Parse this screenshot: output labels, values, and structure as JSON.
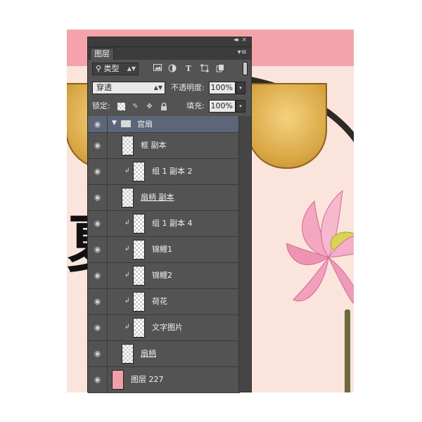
{
  "panel": {
    "title": "图层",
    "collapse_glyph": "◂◂",
    "close_glyph": "×",
    "menu_glyph": "▾≡"
  },
  "filter": {
    "search_glyph": "⚲",
    "kind_label": "类型",
    "icons": [
      "image-filter-icon",
      "adjustment-filter-icon",
      "type-filter-icon",
      "shape-filter-icon",
      "smart-object-filter-icon"
    ]
  },
  "blend": {
    "mode": "穿透",
    "opacity_label": "不透明度:",
    "opacity_value": "100%"
  },
  "lock": {
    "label": "锁定:",
    "fill_label": "填充:",
    "fill_value": "100%"
  },
  "layers": [
    {
      "name": "宫扇",
      "kind": "group",
      "indent": 0
    },
    {
      "name": "框 副本",
      "kind": "layer",
      "indent": 1
    },
    {
      "name": "组 1 副本 2",
      "kind": "clipped",
      "indent": 1
    },
    {
      "name": "扇柄 副本",
      "kind": "layer",
      "indent": 1,
      "underline": true
    },
    {
      "name": "组 1 副本 4",
      "kind": "clipped",
      "indent": 1
    },
    {
      "name": "锦鲤1",
      "kind": "clipped",
      "indent": 1
    },
    {
      "name": "锦鲤2",
      "kind": "clipped",
      "indent": 1
    },
    {
      "name": "荷花",
      "kind": "clipped",
      "indent": 1
    },
    {
      "name": "文字图片",
      "kind": "clipped",
      "indent": 1
    },
    {
      "name": "扇柄",
      "kind": "layer",
      "indent": 1,
      "underline": true
    },
    {
      "name": "图层 227",
      "kind": "fill",
      "indent": 0
    }
  ],
  "canvas": {
    "partial_char": "夏"
  },
  "colors": {
    "panel_bg": "#535353",
    "group_row": "#5c6678",
    "canvas_pink": "#f4a3ab",
    "fan_gold": "#d7a442"
  }
}
